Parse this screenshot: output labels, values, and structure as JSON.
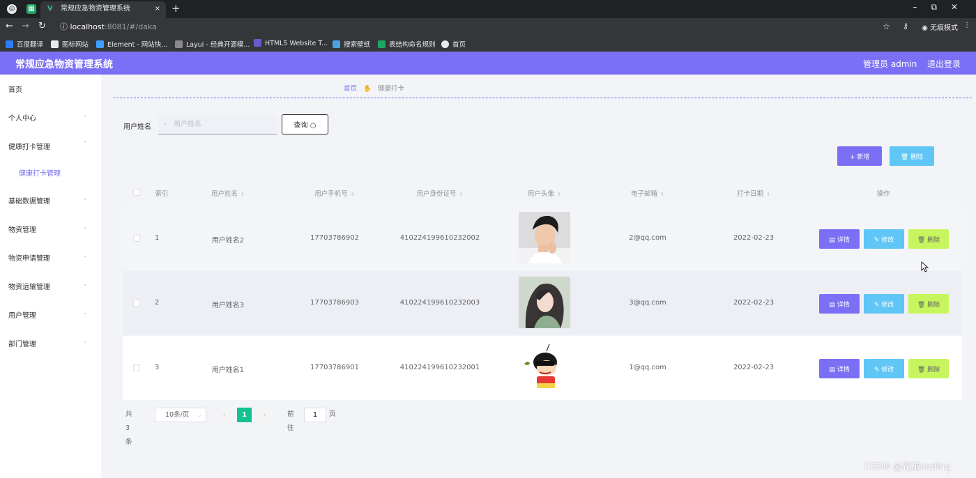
{
  "browser": {
    "tab_title": "常规应急物资管理系统",
    "tab_logo": "V",
    "tab_close": "×",
    "new_tab": "+",
    "window_controls": "–⧉✕",
    "url_host": "localhost",
    "url_path": ":8081/#/daka",
    "incognito_label": "无痕模式",
    "bookmarks": [
      {
        "label": "百度翻译",
        "icon": "baidu-translate-icon",
        "color": "#2f7df6"
      },
      {
        "label": "图标网站",
        "icon": "flag-icon",
        "color": "#e8eaed"
      },
      {
        "label": "Element - 网站快...",
        "icon": "element-icon",
        "color": "#409eff"
      },
      {
        "label": "Layui - 经典开源模...",
        "icon": "layui-icon",
        "color": "#8a8a8a"
      },
      {
        "label": "HTML5 Website T...",
        "icon": "html5-icon",
        "color": "#6a5acd"
      },
      {
        "label": "搜索壁纸",
        "icon": "wallpaper-icon",
        "color": "#4aa3df"
      },
      {
        "label": "表结构命名规则",
        "icon": "doc-icon",
        "color": "#1fa463"
      },
      {
        "label": "首页",
        "icon": "globe-icon",
        "color": "#e8eaed"
      }
    ]
  },
  "header": {
    "title": "常规应急物资管理系统",
    "user": "管理员 admin",
    "logout": "退出登录"
  },
  "sidebar": {
    "items": [
      {
        "label": "首页"
      },
      {
        "label": "个人中心"
      },
      {
        "label": "健康打卡管理"
      },
      {
        "label": "健康打卡管理",
        "sub": true
      },
      {
        "label": "基础数据管理"
      },
      {
        "label": "物资管理"
      },
      {
        "label": "物资申请管理"
      },
      {
        "label": "物资运输管理"
      },
      {
        "label": "用户管理"
      },
      {
        "label": "部门管理"
      }
    ]
  },
  "breadcrumb": {
    "home": "首页",
    "current": "健康打卡"
  },
  "search": {
    "label": "用户姓名",
    "placeholder": "用户姓名",
    "button": "查询"
  },
  "actions": {
    "add": "+ 新增",
    "delete": "删除"
  },
  "table": {
    "headers": [
      "索引",
      "用户姓名",
      "用户手机号",
      "用户身份证号",
      "用户头像",
      "电子邮箱",
      "打卡日期",
      "操作"
    ],
    "rows": [
      {
        "index": "1",
        "name": "用户姓名2",
        "phone": "17703786902",
        "id_card": "410224199610232002",
        "avatar": "boy-photo",
        "email": "2@qq.com",
        "date": "2022-02-23"
      },
      {
        "index": "2",
        "name": "用户姓名3",
        "phone": "17703786903",
        "id_card": "410224199610232003",
        "avatar": "girl-photo",
        "email": "3@qq.com",
        "date": "2022-02-23"
      },
      {
        "index": "3",
        "name": "用户姓名1",
        "phone": "17703786901",
        "id_card": "410224199610232001",
        "avatar": "cartoon-character",
        "email": "1@qq.com",
        "date": "2022-02-23"
      }
    ],
    "row_actions": {
      "detail": "详情",
      "edit": "修改",
      "delete": "删除"
    }
  },
  "pagination": {
    "total": "共 3 条",
    "page_size": "10条/页",
    "current_page": "1",
    "goto_prefix": "前往",
    "goto_value": "1",
    "goto_suffix": "页",
    "prev": "‹",
    "next": "›"
  },
  "watermark": "CSDN @花椒coding",
  "colors": {
    "accent": "#7b70f5",
    "info": "#5fc6f6",
    "lime": "#c7f55e",
    "pager": "#13c28e"
  }
}
